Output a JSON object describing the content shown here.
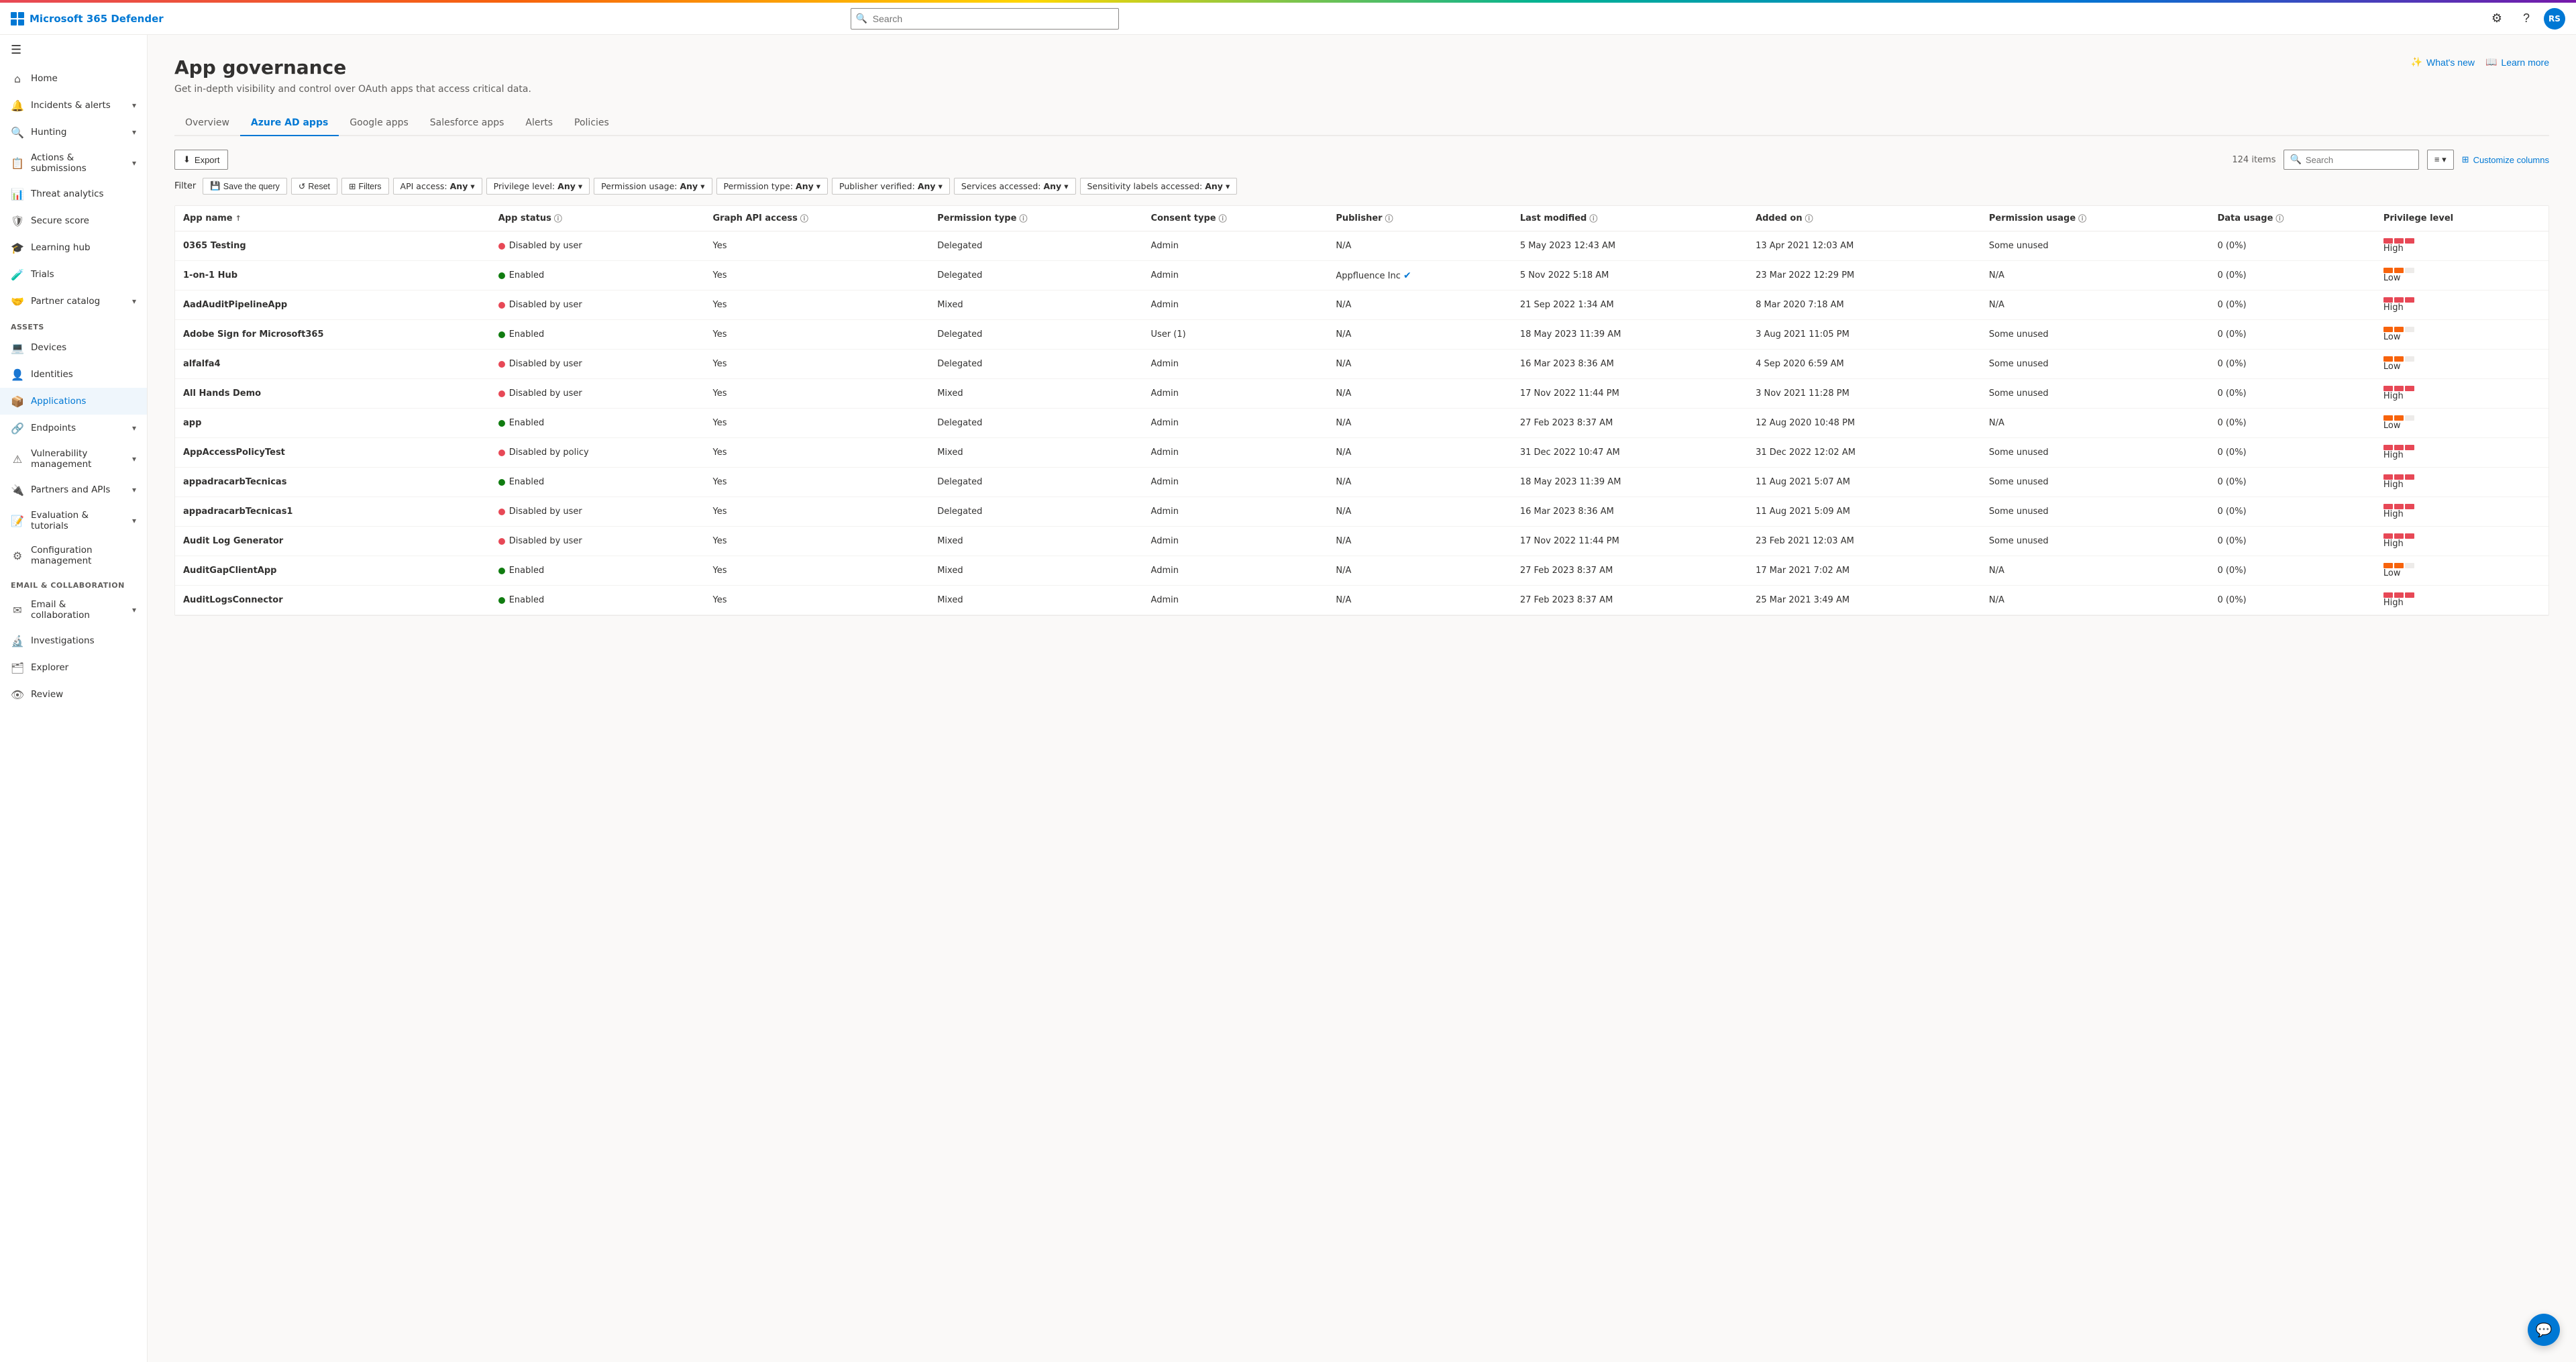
{
  "app": {
    "title": "Microsoft 365 Defender",
    "search_placeholder": "Search",
    "avatar_initials": "RS"
  },
  "topbar": {
    "search_placeholder": "Search",
    "whats_new_label": "What's new",
    "learn_more_label": "Learn more"
  },
  "sidebar": {
    "toggle_icon": "☰",
    "items": [
      {
        "id": "home",
        "label": "Home",
        "icon": "⌂",
        "expandable": false
      },
      {
        "id": "incidents",
        "label": "Incidents & alerts",
        "icon": "🔔",
        "expandable": true
      },
      {
        "id": "hunting",
        "label": "Hunting",
        "icon": "🔍",
        "expandable": true
      },
      {
        "id": "actions",
        "label": "Actions & submissions",
        "icon": "📋",
        "expandable": true
      },
      {
        "id": "threat",
        "label": "Threat analytics",
        "icon": "📊",
        "expandable": false
      },
      {
        "id": "secure",
        "label": "Secure score",
        "icon": "🛡",
        "expandable": false
      },
      {
        "id": "learning",
        "label": "Learning hub",
        "icon": "🎓",
        "expandable": false
      },
      {
        "id": "trials",
        "label": "Trials",
        "icon": "🧪",
        "expandable": false
      },
      {
        "id": "partner",
        "label": "Partner catalog",
        "icon": "🤝",
        "expandable": true
      }
    ],
    "assets_section": "Assets",
    "assets_items": [
      {
        "id": "devices",
        "label": "Devices",
        "icon": "💻"
      },
      {
        "id": "identities",
        "label": "Identities",
        "icon": "👤"
      },
      {
        "id": "applications",
        "label": "Applications",
        "icon": "📦",
        "active": true
      }
    ],
    "endpoints_section": "Endpoints",
    "endpoints_items": [
      {
        "id": "endpoints",
        "label": "Endpoints",
        "icon": "🔗",
        "expandable": true
      },
      {
        "id": "vulnerability",
        "label": "Vulnerability management",
        "icon": "⚠",
        "expandable": true
      },
      {
        "id": "partners",
        "label": "Partners and APIs",
        "icon": "🔌",
        "expandable": true
      },
      {
        "id": "evaluation",
        "label": "Evaluation & tutorials",
        "icon": "📝",
        "expandable": true
      },
      {
        "id": "configuration",
        "label": "Configuration management",
        "icon": "⚙"
      }
    ],
    "collab_section": "Email & collaboration",
    "collab_items": [
      {
        "id": "email-collab",
        "label": "Email & collaboration",
        "icon": "✉",
        "expandable": true
      },
      {
        "id": "investigations",
        "label": "Investigations",
        "icon": "🔬"
      },
      {
        "id": "explorer",
        "label": "Explorer",
        "icon": "🗂"
      },
      {
        "id": "review",
        "label": "Review",
        "icon": "👁"
      }
    ]
  },
  "page": {
    "title": "App governance",
    "subtitle": "Get in-depth visibility and control over OAuth apps that access critical data."
  },
  "tabs": [
    {
      "id": "overview",
      "label": "Overview",
      "active": false
    },
    {
      "id": "azure-ad-apps",
      "label": "Azure AD apps",
      "active": true
    },
    {
      "id": "google-apps",
      "label": "Google apps",
      "active": false
    },
    {
      "id": "salesforce-apps",
      "label": "Salesforce apps",
      "active": false
    },
    {
      "id": "alerts",
      "label": "Alerts",
      "active": false
    },
    {
      "id": "policies",
      "label": "Policies",
      "active": false
    }
  ],
  "toolbar": {
    "export_label": "Export",
    "filter_label": "Filter",
    "save_query_label": "Save the query",
    "reset_label": "Reset",
    "filters_label": "Filters",
    "item_count": "124 items",
    "search_placeholder": "Search",
    "customize_columns_label": "Customize columns"
  },
  "filter_dropdowns": [
    {
      "label": "API access:",
      "value": "Any"
    },
    {
      "label": "Privilege level:",
      "value": "Any"
    },
    {
      "label": "Permission usage:",
      "value": "Any"
    },
    {
      "label": "Permission type:",
      "value": "Any"
    },
    {
      "label": "Publisher verified:",
      "value": "Any"
    },
    {
      "label": "Services accessed:",
      "value": "Any"
    },
    {
      "label": "Sensitivity labels accessed:",
      "value": "Any"
    }
  ],
  "table": {
    "columns": [
      {
        "id": "app-name",
        "label": "App name",
        "sortable": true,
        "info": false
      },
      {
        "id": "app-status",
        "label": "App status",
        "sortable": false,
        "info": true
      },
      {
        "id": "graph-api",
        "label": "Graph API access",
        "sortable": false,
        "info": true
      },
      {
        "id": "permission-type",
        "label": "Permission type",
        "sortable": false,
        "info": true
      },
      {
        "id": "consent-type",
        "label": "Consent type",
        "sortable": false,
        "info": true
      },
      {
        "id": "publisher",
        "label": "Publisher",
        "sortable": false,
        "info": true
      },
      {
        "id": "last-modified",
        "label": "Last modified",
        "sortable": false,
        "info": true
      },
      {
        "id": "added-on",
        "label": "Added on",
        "sortable": false,
        "info": true
      },
      {
        "id": "permission-usage",
        "label": "Permission usage",
        "sortable": false,
        "info": true
      },
      {
        "id": "data-usage",
        "label": "Data usage",
        "sortable": false,
        "info": true
      },
      {
        "id": "privilege-level",
        "label": "Privilege level",
        "sortable": false,
        "info": false
      }
    ],
    "rows": [
      {
        "app_name": "0365 Testing",
        "app_status": "Disabled by user",
        "app_status_type": "disabled",
        "graph_api": "Yes",
        "permission_type": "Delegated",
        "consent_type": "Admin",
        "publisher": "N/A",
        "last_modified": "5 May 2023 12:43 AM",
        "added_on": "13 Apr 2021 12:03 AM",
        "permission_usage": "Some unused",
        "data_usage": "0 (0%)",
        "privilege_level": "High",
        "privilege_color": "red",
        "verified": false
      },
      {
        "app_name": "1-on-1 Hub",
        "app_status": "Enabled",
        "app_status_type": "enabled",
        "graph_api": "Yes",
        "permission_type": "Delegated",
        "consent_type": "Admin",
        "publisher": "Appfluence Inc",
        "last_modified": "5 Nov 2022 5:18 AM",
        "added_on": "23 Mar 2022 12:29 PM",
        "permission_usage": "N/A",
        "data_usage": "0 (0%)",
        "privilege_level": "Low",
        "privilege_color": "orange",
        "verified": true
      },
      {
        "app_name": "AadAuditPipelineApp",
        "app_status": "Disabled by user",
        "app_status_type": "disabled",
        "graph_api": "Yes",
        "permission_type": "Mixed",
        "consent_type": "Admin",
        "publisher": "N/A",
        "last_modified": "21 Sep 2022 1:34 AM",
        "added_on": "8 Mar 2020 7:18 AM",
        "permission_usage": "N/A",
        "data_usage": "0 (0%)",
        "privilege_level": "High",
        "privilege_color": "red",
        "verified": false
      },
      {
        "app_name": "Adobe Sign for Microsoft365",
        "app_status": "Enabled",
        "app_status_type": "enabled",
        "graph_api": "Yes",
        "permission_type": "Delegated",
        "consent_type": "User (1)",
        "publisher": "N/A",
        "last_modified": "18 May 2023 11:39 AM",
        "added_on": "3 Aug 2021 11:05 PM",
        "permission_usage": "Some unused",
        "data_usage": "0 (0%)",
        "privilege_level": "Low",
        "privilege_color": "orange",
        "verified": false
      },
      {
        "app_name": "alfalfa4",
        "app_status": "Disabled by user",
        "app_status_type": "disabled",
        "graph_api": "Yes",
        "permission_type": "Delegated",
        "consent_type": "Admin",
        "publisher": "N/A",
        "last_modified": "16 Mar 2023 8:36 AM",
        "added_on": "4 Sep 2020 6:59 AM",
        "permission_usage": "Some unused",
        "data_usage": "0 (0%)",
        "privilege_level": "Low",
        "privilege_color": "orange",
        "verified": false
      },
      {
        "app_name": "All Hands Demo",
        "app_status": "Disabled by user",
        "app_status_type": "disabled",
        "graph_api": "Yes",
        "permission_type": "Mixed",
        "consent_type": "Admin",
        "publisher": "N/A",
        "last_modified": "17 Nov 2022 11:44 PM",
        "added_on": "3 Nov 2021 11:28 PM",
        "permission_usage": "Some unused",
        "data_usage": "0 (0%)",
        "privilege_level": "High",
        "privilege_color": "red",
        "verified": false
      },
      {
        "app_name": "app",
        "app_status": "Enabled",
        "app_status_type": "enabled",
        "graph_api": "Yes",
        "permission_type": "Delegated",
        "consent_type": "Admin",
        "publisher": "N/A",
        "last_modified": "27 Feb 2023 8:37 AM",
        "added_on": "12 Aug 2020 10:48 PM",
        "permission_usage": "N/A",
        "data_usage": "0 (0%)",
        "privilege_level": "Low",
        "privilege_color": "orange",
        "verified": false
      },
      {
        "app_name": "AppAccessPolicyTest",
        "app_status": "Disabled by policy",
        "app_status_type": "disabled",
        "graph_api": "Yes",
        "permission_type": "Mixed",
        "consent_type": "Admin",
        "publisher": "N/A",
        "last_modified": "31 Dec 2022 10:47 AM",
        "added_on": "31 Dec 2022 12:02 AM",
        "permission_usage": "Some unused",
        "data_usage": "0 (0%)",
        "privilege_level": "High",
        "privilege_color": "red",
        "verified": false
      },
      {
        "app_name": "appadracarbTecnicas",
        "app_status": "Enabled",
        "app_status_type": "enabled",
        "graph_api": "Yes",
        "permission_type": "Delegated",
        "consent_type": "Admin",
        "publisher": "N/A",
        "last_modified": "18 May 2023 11:39 AM",
        "added_on": "11 Aug 2021 5:07 AM",
        "permission_usage": "Some unused",
        "data_usage": "0 (0%)",
        "privilege_level": "High",
        "privilege_color": "red",
        "verified": false
      },
      {
        "app_name": "appadracarbTecnicas1",
        "app_status": "Disabled by user",
        "app_status_type": "disabled",
        "graph_api": "Yes",
        "permission_type": "Delegated",
        "consent_type": "Admin",
        "publisher": "N/A",
        "last_modified": "16 Mar 2023 8:36 AM",
        "added_on": "11 Aug 2021 5:09 AM",
        "permission_usage": "Some unused",
        "data_usage": "0 (0%)",
        "privilege_level": "High",
        "privilege_color": "red",
        "verified": false
      },
      {
        "app_name": "Audit Log Generator",
        "app_status": "Disabled by user",
        "app_status_type": "disabled",
        "graph_api": "Yes",
        "permission_type": "Mixed",
        "consent_type": "Admin",
        "publisher": "N/A",
        "last_modified": "17 Nov 2022 11:44 PM",
        "added_on": "23 Feb 2021 12:03 AM",
        "permission_usage": "Some unused",
        "data_usage": "0 (0%)",
        "privilege_level": "High",
        "privilege_color": "red",
        "verified": false
      },
      {
        "app_name": "AuditGapClientApp",
        "app_status": "Enabled",
        "app_status_type": "enabled",
        "graph_api": "Yes",
        "permission_type": "Mixed",
        "consent_type": "Admin",
        "publisher": "N/A",
        "last_modified": "27 Feb 2023 8:37 AM",
        "added_on": "17 Mar 2021 7:02 AM",
        "permission_usage": "N/A",
        "data_usage": "0 (0%)",
        "privilege_level": "Low",
        "privilege_color": "orange",
        "verified": false
      },
      {
        "app_name": "AuditLogsConnector",
        "app_status": "Enabled",
        "app_status_type": "enabled",
        "graph_api": "Yes",
        "permission_type": "Mixed",
        "consent_type": "Admin",
        "publisher": "N/A",
        "last_modified": "27 Feb 2023 8:37 AM",
        "added_on": "25 Mar 2021 3:49 AM",
        "permission_usage": "N/A",
        "data_usage": "0 (0%)",
        "privilege_level": "High",
        "privilege_color": "red",
        "verified": false
      }
    ]
  }
}
